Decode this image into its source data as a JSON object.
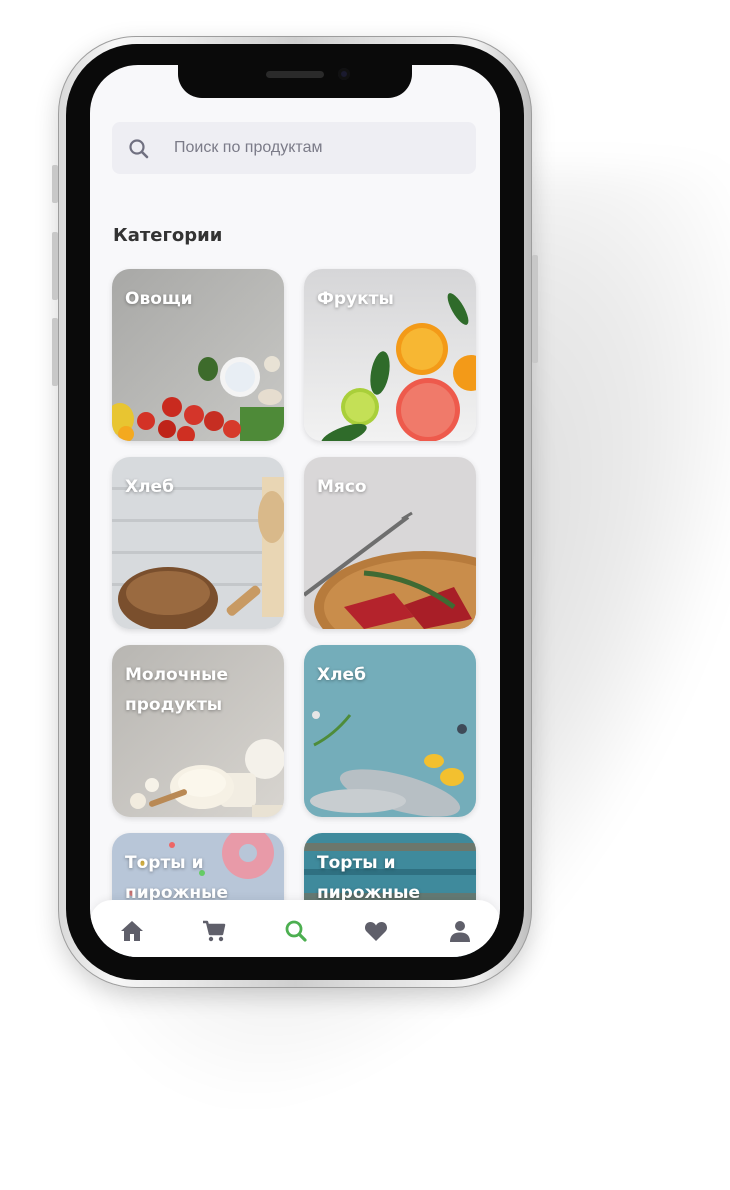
{
  "search": {
    "placeholder": "Поиск по продуктам"
  },
  "categories": {
    "title": "Категории",
    "items": [
      {
        "label": "Овощи"
      },
      {
        "label": "Фрукты"
      },
      {
        "label": "Хлеб"
      },
      {
        "label": "Мясо"
      },
      {
        "label": "Молочные продукты"
      },
      {
        "label": "Хлеб"
      },
      {
        "label": "Торты и пирожные"
      },
      {
        "label": "Торты и пирожные"
      }
    ]
  },
  "tabbar": {
    "tabs": [
      {
        "icon": "home-icon",
        "active": false
      },
      {
        "icon": "cart-icon",
        "active": false
      },
      {
        "icon": "search-icon",
        "active": true
      },
      {
        "icon": "heart-icon",
        "active": false
      },
      {
        "icon": "user-icon",
        "active": false
      }
    ]
  },
  "colors": {
    "accent": "#4caf50",
    "tab_inactive": "#5f5f6a",
    "search_bg": "#eeeef3"
  }
}
